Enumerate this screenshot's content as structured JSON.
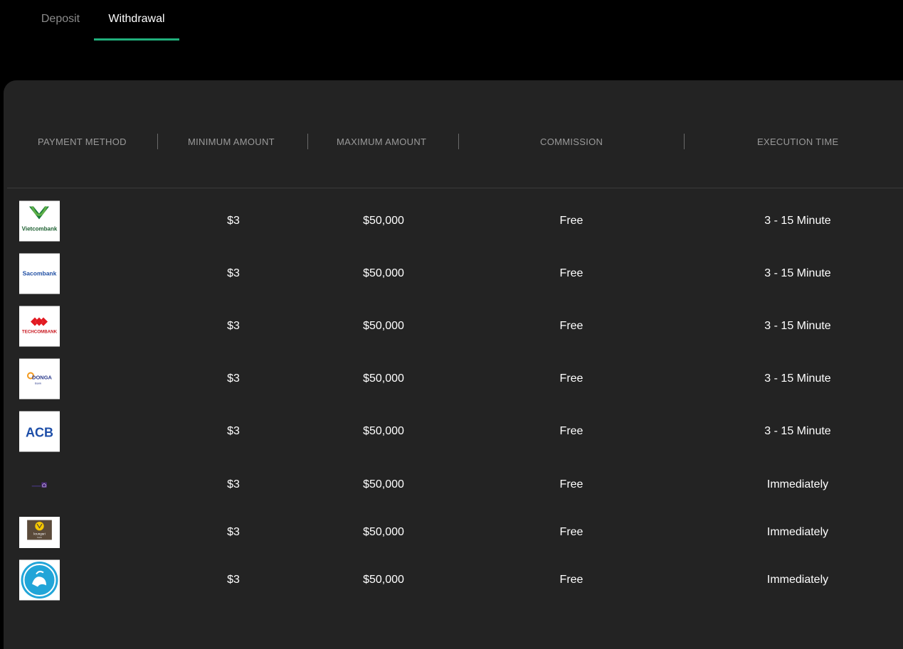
{
  "tabs": {
    "deposit": "Deposit",
    "withdrawal": "Withdrawal",
    "active": "withdrawal"
  },
  "colors": {
    "accent": "#21b07c",
    "panel": "#232323",
    "background": "#000000"
  },
  "table": {
    "headers": {
      "method": "PAYMENT METHOD",
      "min": "MINIMUM AMOUNT",
      "max": "MAXIMUM AMOUNT",
      "commission": "COMMISSION",
      "time": "EXECUTION TIME"
    },
    "rows": [
      {
        "bank": "Vietcombank",
        "logo_text": "Vietcombank",
        "min": "$3",
        "max": "$50,000",
        "commission": "Free",
        "time": "3 - 15 Minute"
      },
      {
        "bank": "Sacombank",
        "logo_text": "Sacombank",
        "min": "$3",
        "max": "$50,000",
        "commission": "Free",
        "time": "3 - 15 Minute"
      },
      {
        "bank": "Techcombank",
        "logo_text": "TECHCOMBANK",
        "min": "$3",
        "max": "$50,000",
        "commission": "Free",
        "time": "3 - 15 Minute"
      },
      {
        "bank": "DongA Bank",
        "logo_text": "DONGA",
        "min": "$3",
        "max": "$50,000",
        "commission": "Free",
        "time": "3 - 15 Minute"
      },
      {
        "bank": "ACB",
        "logo_text": "ACB",
        "min": "$3",
        "max": "$50,000",
        "commission": "Free",
        "time": "3 - 15 Minute"
      },
      {
        "bank": "SCB",
        "logo_text": "",
        "min": "$3",
        "max": "$50,000",
        "commission": "Free",
        "time": "Immediately"
      },
      {
        "bank": "Krungsri",
        "logo_text": "krungsri",
        "min": "$3",
        "max": "$50,000",
        "commission": "Free",
        "time": "Immediately"
      },
      {
        "bank": "Kasikornbank",
        "logo_text": "",
        "min": "$3",
        "max": "$50,000",
        "commission": "Free",
        "time": "Immediately"
      }
    ]
  }
}
